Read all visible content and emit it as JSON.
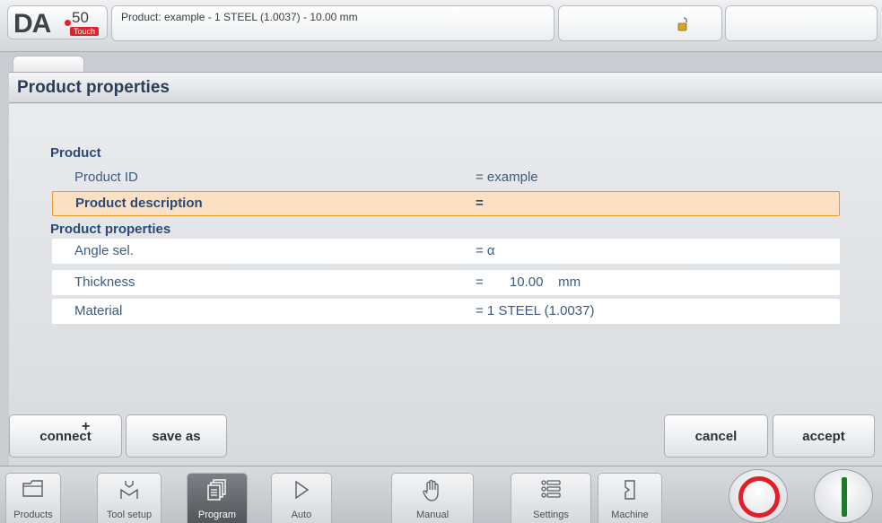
{
  "header": {
    "logo_main": "DA",
    "logo_number": "50",
    "logo_badge": "Touch",
    "title": "Product: example - 1 STEEL (1.0037) - 10.00 mm",
    "lock_icon": "unlocked-padlock-icon"
  },
  "panel": {
    "title": "Product properties"
  },
  "sections": {
    "product": "Product",
    "properties": "Product properties"
  },
  "rows": [
    {
      "label": "Product ID",
      "value": "= example",
      "state": "normal"
    },
    {
      "label": "Product description",
      "value": "=",
      "state": "selected"
    },
    {
      "label": "Angle sel.",
      "value": "= α",
      "state": "normal"
    },
    {
      "label": "Thickness",
      "value": "=       10.00    mm",
      "state": "normal"
    },
    {
      "label": "Material",
      "value": "= 1 STEEL (1.0037)",
      "state": "normal"
    }
  ],
  "softkeys": {
    "connect": "connect",
    "connect_badge": "+",
    "save_as": "save as",
    "cancel": "cancel",
    "accept": "accept"
  },
  "nav": {
    "products": "Products",
    "tool_setup": "Tool setup",
    "program": "Program",
    "auto": "Auto",
    "manual": "Manual",
    "settings": "Settings",
    "machine": "Machine",
    "active": "Program"
  },
  "colors": {
    "section_text": "#2c4a75",
    "selected_fill": "#fbe0c4",
    "selected_border": "#e8992f",
    "stop": "#e11f26",
    "start": "#1c7a2a"
  }
}
